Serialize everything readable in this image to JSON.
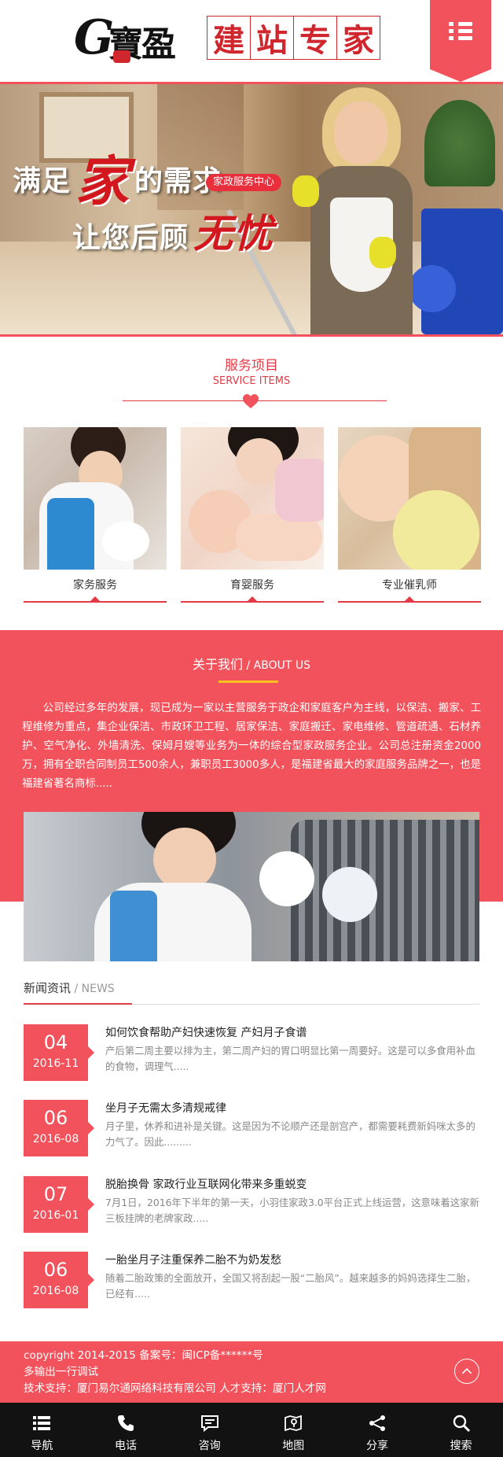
{
  "header": {
    "logo_letter": "G",
    "logo_name": "寶盈",
    "logo_slogan_chars": [
      "建",
      "站",
      "专",
      "家"
    ]
  },
  "banner": {
    "line1_pre": "满足",
    "line1_highlight": "家",
    "line1_post": "的需求",
    "tag": "家政服务中心",
    "line2_pre": "让您后顾",
    "line2_highlight": "无忧"
  },
  "services": {
    "title_cn": "服务项目",
    "title_en": "SERVICE ITEMS",
    "items": [
      {
        "label": "家务服务"
      },
      {
        "label": "育婴服务"
      },
      {
        "label": "专业催乳师"
      }
    ]
  },
  "about": {
    "title_cn": "关于我们",
    "title_en": " / ABOUT US",
    "text": "公司经过多年的发展，现已成为一家以主营服务于政企和家庭客户为主线，以保洁、搬家、工程维修为重点，集企业保洁、市政环卫工程、居家保洁、家庭搬迁、家电维修、管道疏通、石材养护、空气净化、外墙清洗、保姆月嫂等业务为一体的综合型家政服务企业。公司总注册资金2000万，拥有全职合同制员工500余人，兼职员工3000多人，是福建省最大的家庭服务品牌之一，也是福建省著名商标....."
  },
  "news": {
    "title_cn": "新闻资讯",
    "title_en": " / NEWS",
    "items": [
      {
        "day": "04",
        "ym": "2016-11",
        "title": "如何饮食帮助产妇快速恢复 产妇月子食谱",
        "summary": "产后第二周主要以排为主，第二周产妇的胃口明显比第一周要好。这是可以多食用补血的食物，调理气....."
      },
      {
        "day": "06",
        "ym": "2016-08",
        "title": "坐月子无需太多清规戒律",
        "summary": "月子里，休养和进补是关键。这是因为不论顺产还是剖宫产，都需要耗费新妈咪太多的力气了。因此........."
      },
      {
        "day": "07",
        "ym": "2016-01",
        "title": "脱胎换骨 家政行业互联网化带来多重蜕变",
        "summary": "7月1日，2016年下半年的第一天，小羽佳家政3.0平台正式上线运营，这意味着这家新三板挂牌的老牌家政....."
      },
      {
        "day": "06",
        "ym": "2016-08",
        "title": "一胎坐月子注重保养二胎不为奶发愁",
        "summary": "随着二胎政策的全面放开，全国又将刮起一股“二胎风”。越来越多的妈妈选择生二胎，已经有....."
      }
    ]
  },
  "footer": {
    "line1": "copyright 2014-2015 备案号：闽ICP备******号",
    "line2": "多输出一行调试",
    "line3": "技术支持：厦门易尔通网络科技有限公司 人才支持：厦门人才网"
  },
  "bottom_nav": [
    {
      "label": "导航",
      "icon": "list-icon"
    },
    {
      "label": "电话",
      "icon": "phone-icon"
    },
    {
      "label": "咨询",
      "icon": "chat-icon"
    },
    {
      "label": "地图",
      "icon": "map-icon"
    },
    {
      "label": "分享",
      "icon": "share-icon"
    },
    {
      "label": "搜索",
      "icon": "search-icon"
    }
  ],
  "colors": {
    "accent": "#f2525b",
    "title_red": "#e43a45",
    "nav_bg": "#121212",
    "underline_yellow": "#f7c21e"
  }
}
